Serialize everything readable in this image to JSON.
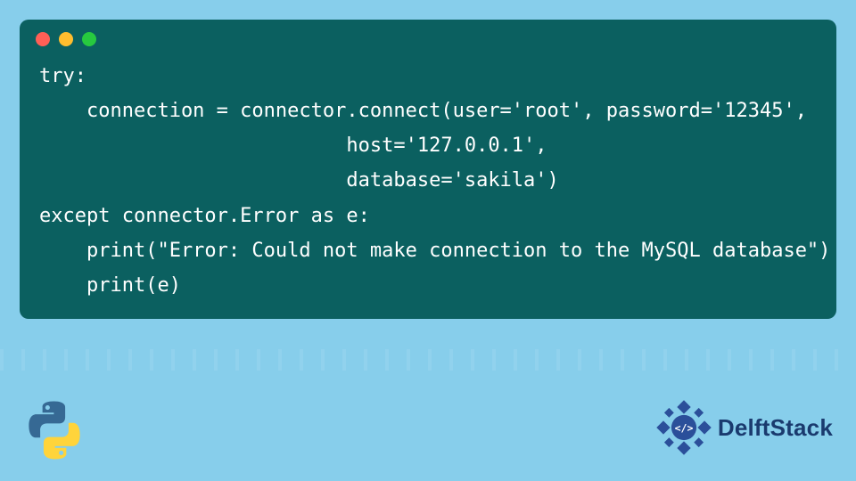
{
  "window": {
    "traffic_lights": {
      "red": "close-icon",
      "yellow": "minimize-icon",
      "green": "maximize-icon"
    }
  },
  "code": {
    "lines": [
      "try:",
      "    connection = connector.connect(user='root', password='12345',",
      "                          host='127.0.0.1',",
      "                          database='sakila')",
      "except connector.Error as e:",
      "    print(\"Error: Could not make connection to the MySQL database\")",
      "    print(e)"
    ]
  },
  "branding": {
    "python_icon": "python-logo-icon",
    "delft_icon": "delftstack-logo-icon",
    "delft_label": "DelftStack"
  },
  "colors": {
    "page_bg": "#87ceeb",
    "window_bg": "#0b6060",
    "code_text": "#ffffff",
    "brand_text": "#1a3a6e",
    "python_blue": "#366994",
    "python_yellow": "#ffd43b",
    "delft_blue": "#2b4f9a"
  }
}
